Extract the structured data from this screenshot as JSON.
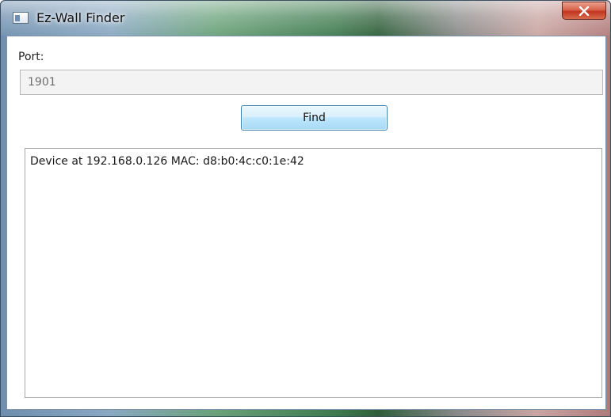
{
  "window": {
    "title": "Ez-Wall Finder"
  },
  "form": {
    "port_label": "Port:",
    "port_value": "1901",
    "find_label": "Find"
  },
  "output": {
    "lines": [
      "Device at 192.168.0.126 MAC: d8:b0:4c:c0:1e:42"
    ]
  },
  "icons": {
    "app": "window-app-icon",
    "close": "close-icon"
  }
}
